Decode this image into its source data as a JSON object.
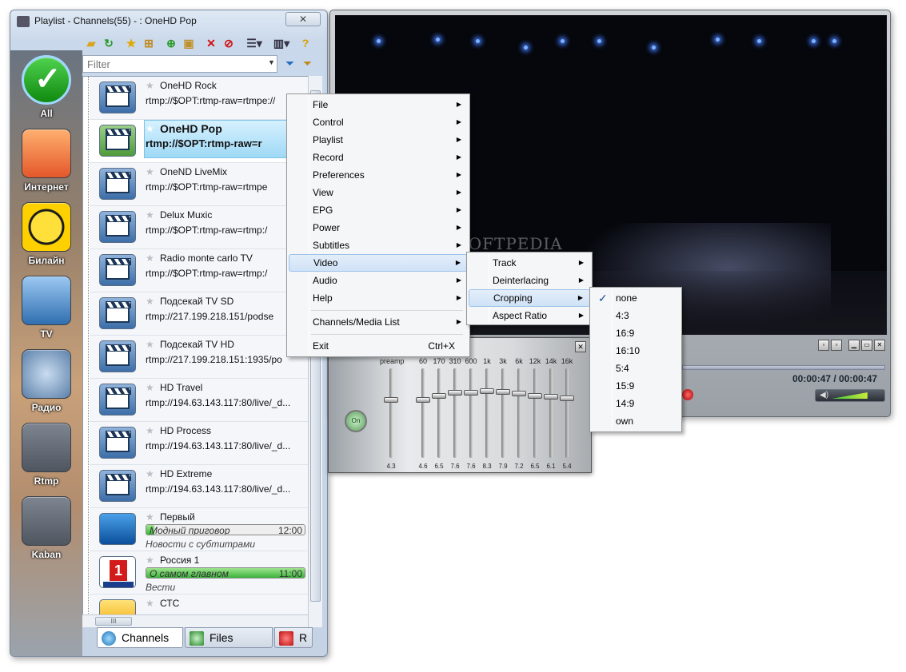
{
  "playlist": {
    "title": "Playlist - Channels(55) -  : OneHD Pop",
    "close_glyph": "✕",
    "filter_placeholder": "Filter",
    "sidebar": [
      {
        "label": "All",
        "icon": "checkmark-icon"
      },
      {
        "label": "Интернет",
        "icon": "folder-globe-icon"
      },
      {
        "label": "Билайн",
        "icon": "beeline-logo-icon"
      },
      {
        "label": "TV",
        "icon": "tv-icon"
      },
      {
        "label": "Радио",
        "icon": "headphones-icon"
      },
      {
        "label": "Rtmp",
        "icon": "blank-tile-icon"
      },
      {
        "label": "Kaban",
        "icon": "blank-tile-icon"
      }
    ],
    "channels": [
      {
        "name": "OneHD Rock",
        "url": "rtmp://$OPT:rtmp-raw=rtmpe://"
      },
      {
        "name": "OneHD Pop",
        "url": "rtmp://$OPT:rtmp-raw=r"
      },
      {
        "name": "OneND LiveMix",
        "url": "rtmp://$OPT:rtmp-raw=rtmpe"
      },
      {
        "name": "Delux Muxic",
        "url": "rtmp://$OPT:rtmp-raw=rtmp:/"
      },
      {
        "name": "Radio monte carlo TV",
        "url": "rtmp://$OPT:rtmp-raw=rtmp:/"
      },
      {
        "name": "Подсекай TV SD",
        "url": "rtmp://217.199.218.151/podse"
      },
      {
        "name": "Подсекай TV HD",
        "url": "rtmp://217.199.218.151:1935/po"
      },
      {
        "name": "HD Travel",
        "url": "rtmp://194.63.143.117:80/live/_d..."
      },
      {
        "name": "HD Process",
        "url": "rtmp://194.63.143.117:80/live/_d..."
      },
      {
        "name": "HD Extreme",
        "url": "rtmp://194.63.143.117:80/live/_d..."
      },
      {
        "name": "Первый",
        "program": "Модный приговор",
        "time": "12:00",
        "progress": 0.05,
        "next": "Новости с субтитрами"
      },
      {
        "name": "Россия 1",
        "program": "О самом главном",
        "time": "11:00",
        "progress": 1.0,
        "next": "Вести"
      },
      {
        "name": "СТС"
      }
    ],
    "tabs": [
      {
        "label": "Channels"
      },
      {
        "label": "Files"
      },
      {
        "label": "R"
      }
    ],
    "hscroll_glyph": "III"
  },
  "player": {
    "time": "00:00:47 / 00:00:47",
    "watermark": "SOFTPEDIA",
    "volume_level": 0.7
  },
  "equalizer": {
    "close_glyph": "✕",
    "onoff": "On",
    "bands": [
      {
        "label": "preamp",
        "value": "4.3",
        "level": 0.35
      },
      {
        "label": "60",
        "value": "4.6",
        "level": 0.35
      },
      {
        "label": "170",
        "value": "6.5",
        "level": 0.3
      },
      {
        "label": "310",
        "value": "7.6",
        "level": 0.27
      },
      {
        "label": "600",
        "value": "7.6",
        "level": 0.27
      },
      {
        "label": "1k",
        "value": "8.3",
        "level": 0.25
      },
      {
        "label": "3k",
        "value": "7.9",
        "level": 0.26
      },
      {
        "label": "6k",
        "value": "7.2",
        "level": 0.28
      },
      {
        "label": "12k",
        "value": "6.5",
        "level": 0.3
      },
      {
        "label": "14k",
        "value": "6.1",
        "level": 0.31
      },
      {
        "label": "16k",
        "value": "5.4",
        "level": 0.33
      }
    ]
  },
  "main_menu": [
    {
      "label": "File",
      "sub": true
    },
    {
      "label": "Control",
      "sub": true
    },
    {
      "label": "Playlist",
      "sub": true
    },
    {
      "label": "Record",
      "sub": true
    },
    {
      "label": "Preferences",
      "sub": true
    },
    {
      "label": "View",
      "sub": true
    },
    {
      "label": "EPG",
      "sub": true
    },
    {
      "label": "Power",
      "sub": true
    },
    {
      "label": "Subtitles",
      "sub": true
    },
    {
      "label": "Video",
      "sub": true,
      "active": true
    },
    {
      "label": "Audio",
      "sub": true
    },
    {
      "label": "Help",
      "sub": true
    },
    {
      "label": "Channels/Media List",
      "sub": true,
      "sep_before": true
    },
    {
      "label": "Exit",
      "shortcut": "Ctrl+X",
      "sep_before": true
    }
  ],
  "video_menu": [
    {
      "label": "Track"
    },
    {
      "label": "Deinterlacing"
    },
    {
      "label": "Cropping",
      "active": true
    },
    {
      "label": "Aspect Ratio"
    }
  ],
  "cropping_menu": [
    {
      "label": "none",
      "checked": true
    },
    {
      "label": "4:3"
    },
    {
      "label": "16:9"
    },
    {
      "label": "16:10"
    },
    {
      "label": "5:4"
    },
    {
      "label": "15:9"
    },
    {
      "label": "14:9"
    },
    {
      "label": "own"
    }
  ],
  "glyphs": {
    "submenu_arrow": "▶",
    "check": "✓",
    "star": "★"
  }
}
